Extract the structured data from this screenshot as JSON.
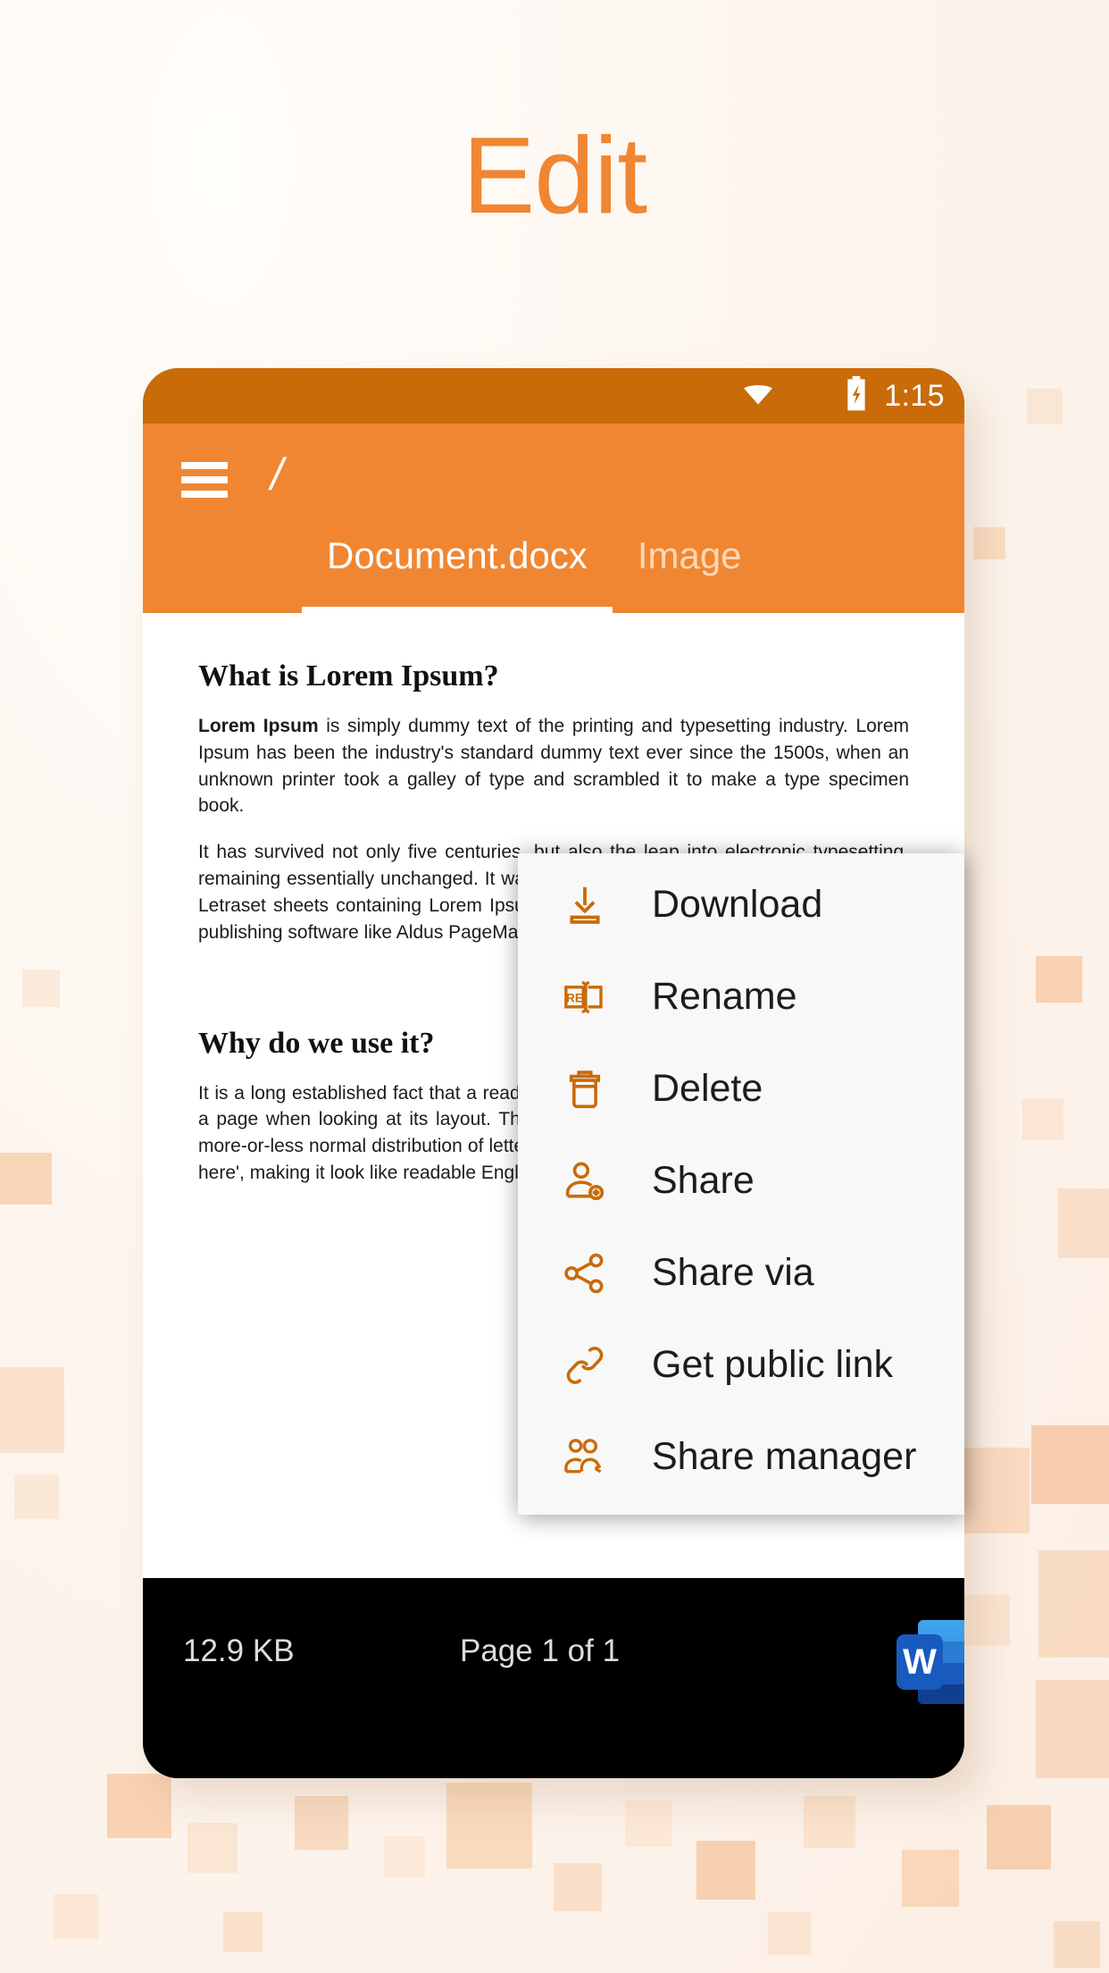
{
  "promo": {
    "headline": "Edit",
    "accent_color": "#f08632",
    "background_color": "#fdf6f0"
  },
  "statusbar": {
    "time": "1:15",
    "wifi_icon": "wifi-icon",
    "battery_icon": "battery-charging-icon",
    "background_color": "#c96b08"
  },
  "appbar": {
    "menu_icon": "hamburger-menu-icon",
    "path_title": "/",
    "background_color": "#f08632",
    "tabs": [
      {
        "label": "Document.docx",
        "active": true
      },
      {
        "label": "Image",
        "active": false
      }
    ]
  },
  "document": {
    "heading1": "What is Lorem Ipsum?",
    "para1_bold": "Lorem Ipsum",
    "para1": " is simply dummy text of the printing and typesetting industry. Lorem Ipsum has been the industry's standard dummy text ever since the 1500s, when an unknown printer took a galley of type and scrambled it to make a type specimen book.",
    "para2": "It has survived not only five centuries, but also the leap into electronic typesetting, remaining essentially unchanged. It was popularised in the 1960s with the release of Letraset sheets containing Lorem Ipsum passages, and more recently with desktop publishing software like Aldus PageMaker including versions of Lorem Ipsum.",
    "heading2": "Why do we use it?",
    "para3": "It is a long established fact that a reader will be distracted by the readable content of a page when looking at its layout. The point of using Lorem Ipsum is that it has a more-or-less normal distribution of letters, as opposed to using 'Content here, content here', making it look like readable English."
  },
  "bottombar": {
    "file_size": "12.9 KB",
    "page_count": "Page 1 of 1",
    "app_icon": "microsoft-word-icon",
    "app_icon_letter": "W",
    "overflow_icon": "overflow-menu-icon",
    "background_color": "#000000"
  },
  "context_menu": {
    "background_color": "#f8f8f8",
    "icon_color": "#c96b08",
    "items": [
      {
        "label": "Download",
        "icon": "download-icon"
      },
      {
        "label": "Rename",
        "icon": "rename-icon"
      },
      {
        "label": "Delete",
        "icon": "trash-icon"
      },
      {
        "label": "Share",
        "icon": "person-add-icon"
      },
      {
        "label": "Share via",
        "icon": "share-nodes-icon"
      },
      {
        "label": "Get public link",
        "icon": "link-chain-icon"
      },
      {
        "label": "Share manager",
        "icon": "people-group-icon"
      }
    ]
  }
}
